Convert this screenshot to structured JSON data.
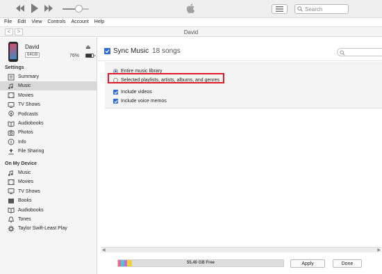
{
  "menu": [
    "File",
    "Edit",
    "View",
    "Controls",
    "Account",
    "Help"
  ],
  "search": {
    "placeholder": "Search"
  },
  "playback": {
    "volume_level": 0.6
  },
  "nav": {
    "title": "David",
    "back": "<",
    "forward": ">"
  },
  "device": {
    "name": "David",
    "capacity": "64GB",
    "battery": "76%",
    "battery_level": 0.76
  },
  "sidebar": {
    "settings_head": "Settings",
    "settings": [
      {
        "label": "Summary",
        "icon": "summary-icon"
      },
      {
        "label": "Music",
        "icon": "music-note-icon"
      },
      {
        "label": "Movies",
        "icon": "film-icon"
      },
      {
        "label": "TV Shows",
        "icon": "tv-icon"
      },
      {
        "label": "Podcasts",
        "icon": "podcast-icon"
      },
      {
        "label": "Audiobooks",
        "icon": "audiobook-icon"
      },
      {
        "label": "Photos",
        "icon": "camera-icon"
      },
      {
        "label": "Info",
        "icon": "info-icon"
      },
      {
        "label": "File Sharing",
        "icon": "file-sharing-icon"
      }
    ],
    "ondevice_head": "On My Device",
    "ondevice": [
      {
        "label": "Music",
        "icon": "music-note-icon"
      },
      {
        "label": "Movies",
        "icon": "film-icon"
      },
      {
        "label": "TV Shows",
        "icon": "tv-icon"
      },
      {
        "label": "Books",
        "icon": "book-icon"
      },
      {
        "label": "Audiobooks",
        "icon": "audiobook-icon"
      },
      {
        "label": "Tones",
        "icon": "bell-icon"
      },
      {
        "label": "Taylor Swift-Least Play",
        "icon": "gear-icon"
      }
    ]
  },
  "main": {
    "sync_title": "Sync Music",
    "sync_count": "18 songs",
    "opt_entire": "Entire music library",
    "opt_selected": "Selected playlists, artists, albums, and genres",
    "chk_videos": "Include videos",
    "chk_memos": "Include voice memos"
  },
  "footer": {
    "free": "55.40 GB Free",
    "apply": "Apply",
    "done": "Done"
  },
  "colors": {
    "accent": "#2e6bd6",
    "highlight": "#e11a2a"
  }
}
